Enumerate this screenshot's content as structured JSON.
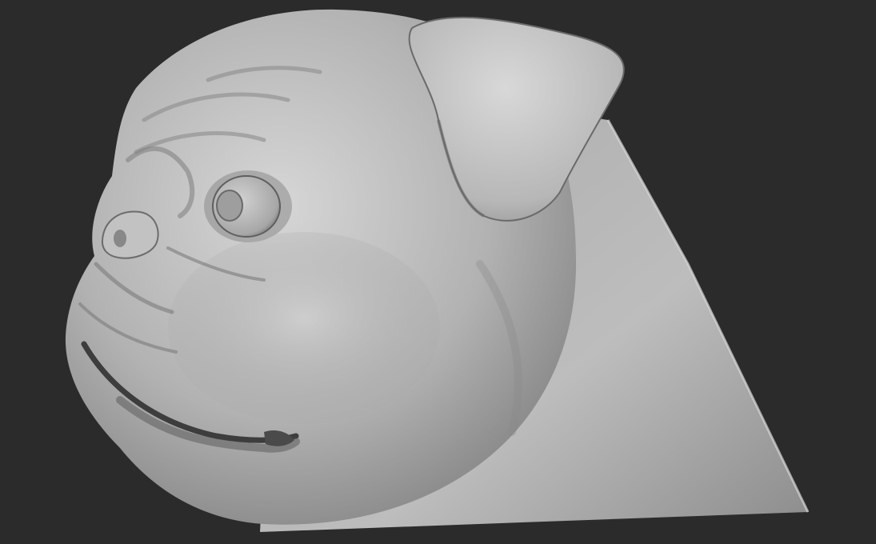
{
  "scene": {
    "subject": "pug-head-sculpt",
    "background_color": "#2b2b2b",
    "material_base_color": "#b4b4b4",
    "material_highlight_color": "#dcdcdc",
    "material_shadow_color": "#5a5a5a"
  }
}
